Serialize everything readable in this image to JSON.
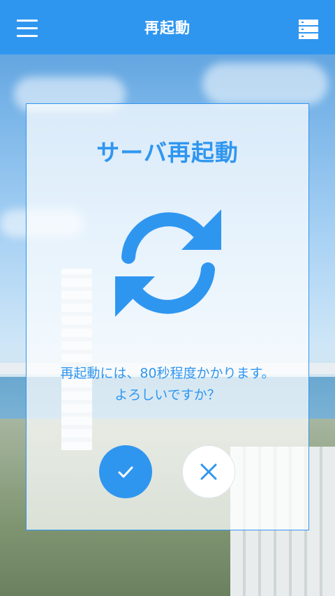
{
  "appbar": {
    "title": "再起動",
    "menu_icon": "hamburger-menu-icon",
    "server_icon": "server-list-icon",
    "background": "#2f96f0"
  },
  "dialog": {
    "title": "サーバ再起動",
    "icon": "refresh-icon",
    "message_line1": "再起動には、80秒程度かかります。",
    "message_line2": "よろしいですか？",
    "confirm_icon": "check-icon",
    "cancel_icon": "close-icon",
    "accent_color": "#2f96f0"
  }
}
